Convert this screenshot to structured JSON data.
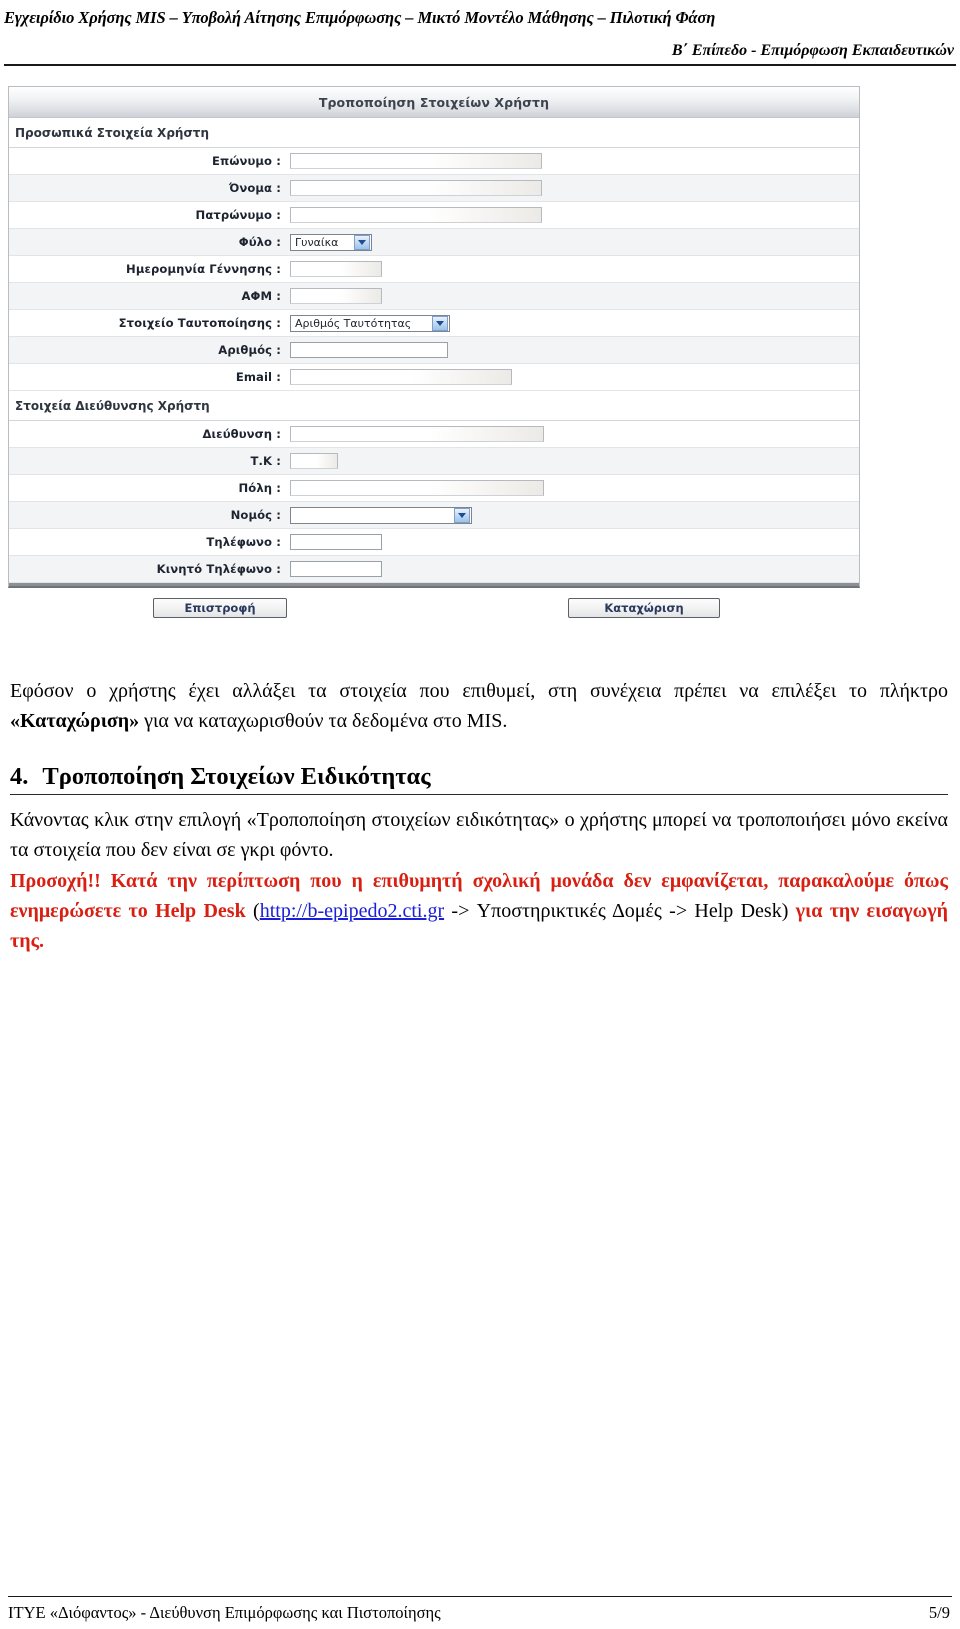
{
  "header": {
    "line1": "Εγχειρίδιο Χρήσης MIS – Υποβολή Αίτησης Επιμόρφωσης – Μικτό Μοντέλο Μάθησης – Πιλοτική Φάση",
    "line2": "Β΄ Επίπεδο - Επιμόρφωση Εκπαιδευτικών"
  },
  "screenshot": {
    "window_title": "Τροποποίηση Στοιχείων Χρήστη",
    "sections": {
      "personal": "Προσωπικά Στοιχεία Χρήστη",
      "address": "Στοιχεία Διεύθυνσης Χρήστη"
    },
    "fields": {
      "lastname": {
        "label": "Επώνυμο :",
        "value": "",
        "type": "text"
      },
      "firstname": {
        "label": "Όνομα :",
        "value": "",
        "type": "text"
      },
      "fathername": {
        "label": "Πατρώνυμο :",
        "value": "",
        "type": "text"
      },
      "gender": {
        "label": "Φύλο :",
        "value": "Γυναίκα",
        "type": "select"
      },
      "birthdate": {
        "label": "Ημερομηνία Γέννησης :",
        "value": "",
        "type": "text"
      },
      "afm": {
        "label": "ΑΦΜ :",
        "value": "",
        "type": "text"
      },
      "ident_type": {
        "label": "Στοιχείο Ταυτοποίησης :",
        "value": "Αριθμός Ταυτότητας",
        "type": "select"
      },
      "ident_number": {
        "label": "Αριθμός :",
        "value": "",
        "type": "text"
      },
      "email": {
        "label": "Email :",
        "value": "",
        "type": "text"
      },
      "address": {
        "label": "Διεύθυνση :",
        "value": "",
        "type": "text"
      },
      "postcode": {
        "label": "Τ.Κ :",
        "value": "",
        "type": "text"
      },
      "city": {
        "label": "Πόλη :",
        "value": "",
        "type": "text"
      },
      "prefecture": {
        "label": "Νομός :",
        "value": "",
        "type": "select"
      },
      "phone": {
        "label": "Τηλέφωνο :",
        "value": "",
        "type": "text"
      },
      "mobile": {
        "label": "Κινητό Τηλέφωνο :",
        "value": "",
        "type": "text"
      }
    },
    "buttons": {
      "back": "Επιστροφή",
      "submit": "Καταχώριση"
    }
  },
  "body": {
    "para1_a": "Εφόσον ο χρήστης έχει αλλάξει τα στοιχεία που επιθυμεί, στη συνέχεια πρέπει να επιλέξει το πλήκτρο ",
    "para1_bold": "«Καταχώριση»",
    "para1_b": " για να καταχωρισθούν τα δεδομένα στο MIS.",
    "heading_number": "4.",
    "heading_text": "Τροποποίηση Στοιχείων Ειδικότητας",
    "para2": "Κάνοντας κλικ στην επιλογή «Τροποποίηση στοιχείων ειδικότητας» ο χρήστης μπορεί να τροποποιήσει μόνο εκείνα τα στοιχεία που δεν είναι σε γκρι φόντο.",
    "warn_a": "Προσοχή!! Κατά την περίπτωση που η επιθυμητή σχολική μονάδα δεν εμφανίζεται, παρακαλούμε όπως ενημερώσετε το Help Desk ",
    "warn_paren_open": "(",
    "warn_link": "http://b-epipedo2.cti.gr",
    "warn_mid": " -> Υποστηρικτικές Δομές -> Help Desk) ",
    "warn_b": "για την εισαγωγή της."
  },
  "footer": {
    "left": "ΙΤΥΕ «Διόφαντος» - Διεύθυνση Επιμόρφωσης και Πιστοποίησης",
    "right": "5/9"
  },
  "colors": {
    "warning": "#d81f12",
    "link": "#1a20d6",
    "titlebar_text": "#3d4450"
  }
}
